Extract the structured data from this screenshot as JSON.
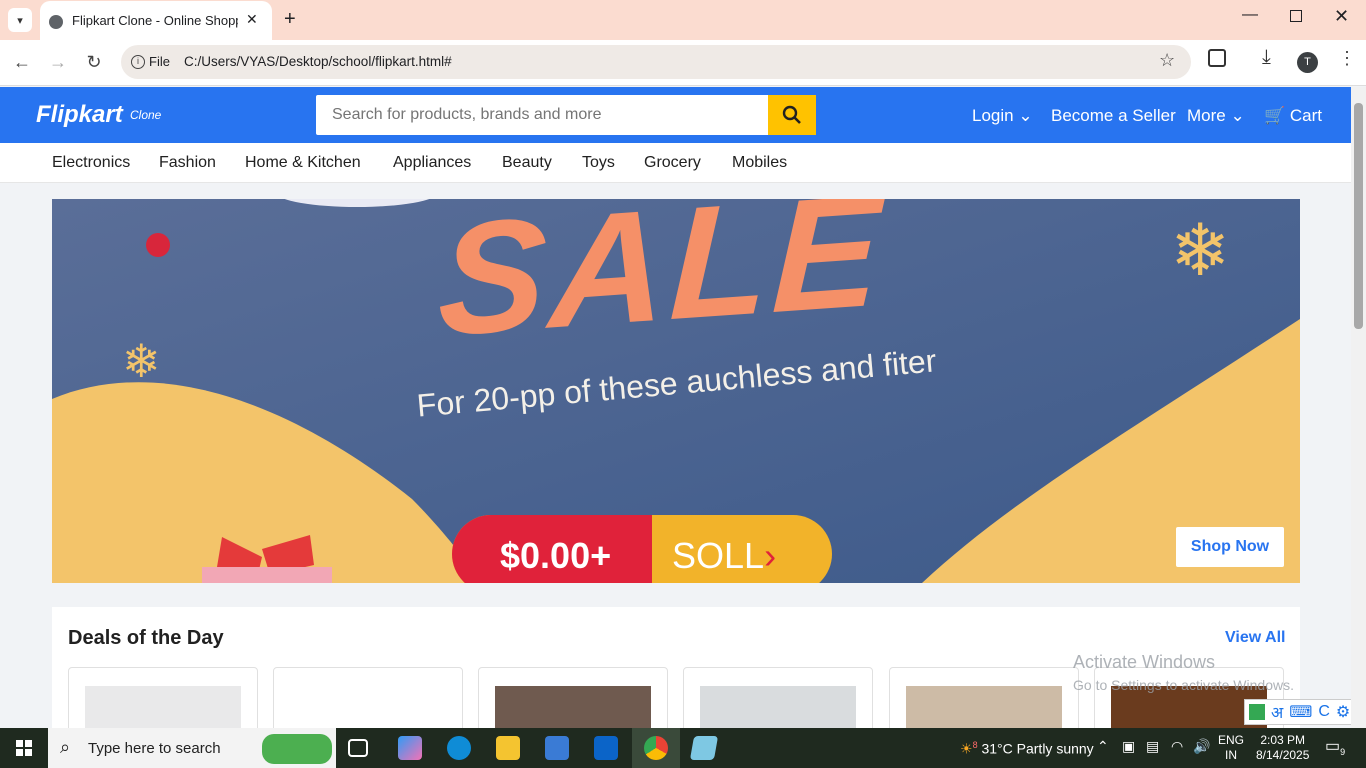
{
  "browser": {
    "tab_title": "Flipkart Clone - Online Shoppin",
    "file_label": "File",
    "url": "C:/Users/VYAS/Desktop/school/flipkart.html#",
    "profile_initial": "T"
  },
  "header": {
    "logo": "Flipkart",
    "logo_sub": "Clone",
    "search_placeholder": "Search for products, brands and more",
    "login": "Login",
    "become_seller": "Become a Seller",
    "more": "More",
    "cart": "Cart"
  },
  "categories": [
    "Electronics",
    "Fashion",
    "Home & Kitchen",
    "Appliances",
    "Beauty",
    "Toys",
    "Grocery",
    "Mobiles"
  ],
  "banner": {
    "headline": "SALE",
    "subline": "For 20-pp of these auchless and fiter",
    "price": "$0.00+",
    "cta_text": "SOLL",
    "shop_now": "Shop Now"
  },
  "deals": {
    "title": "Deals of the Day",
    "view_all": "View All"
  },
  "watermark": {
    "line1": "Activate Windows",
    "line2": "Go to Settings to activate Windows."
  },
  "taskbar": {
    "search": "Type here to search",
    "weather_temp": "31°C",
    "weather_desc": "Partly sunny",
    "weather_alert": "8",
    "lang1": "ENG",
    "lang2": "IN",
    "time": "2:03 PM",
    "date": "8/14/2025",
    "notifications": "9"
  },
  "colors": {
    "brand": "#2874f0",
    "search_button": "#ffc200"
  }
}
